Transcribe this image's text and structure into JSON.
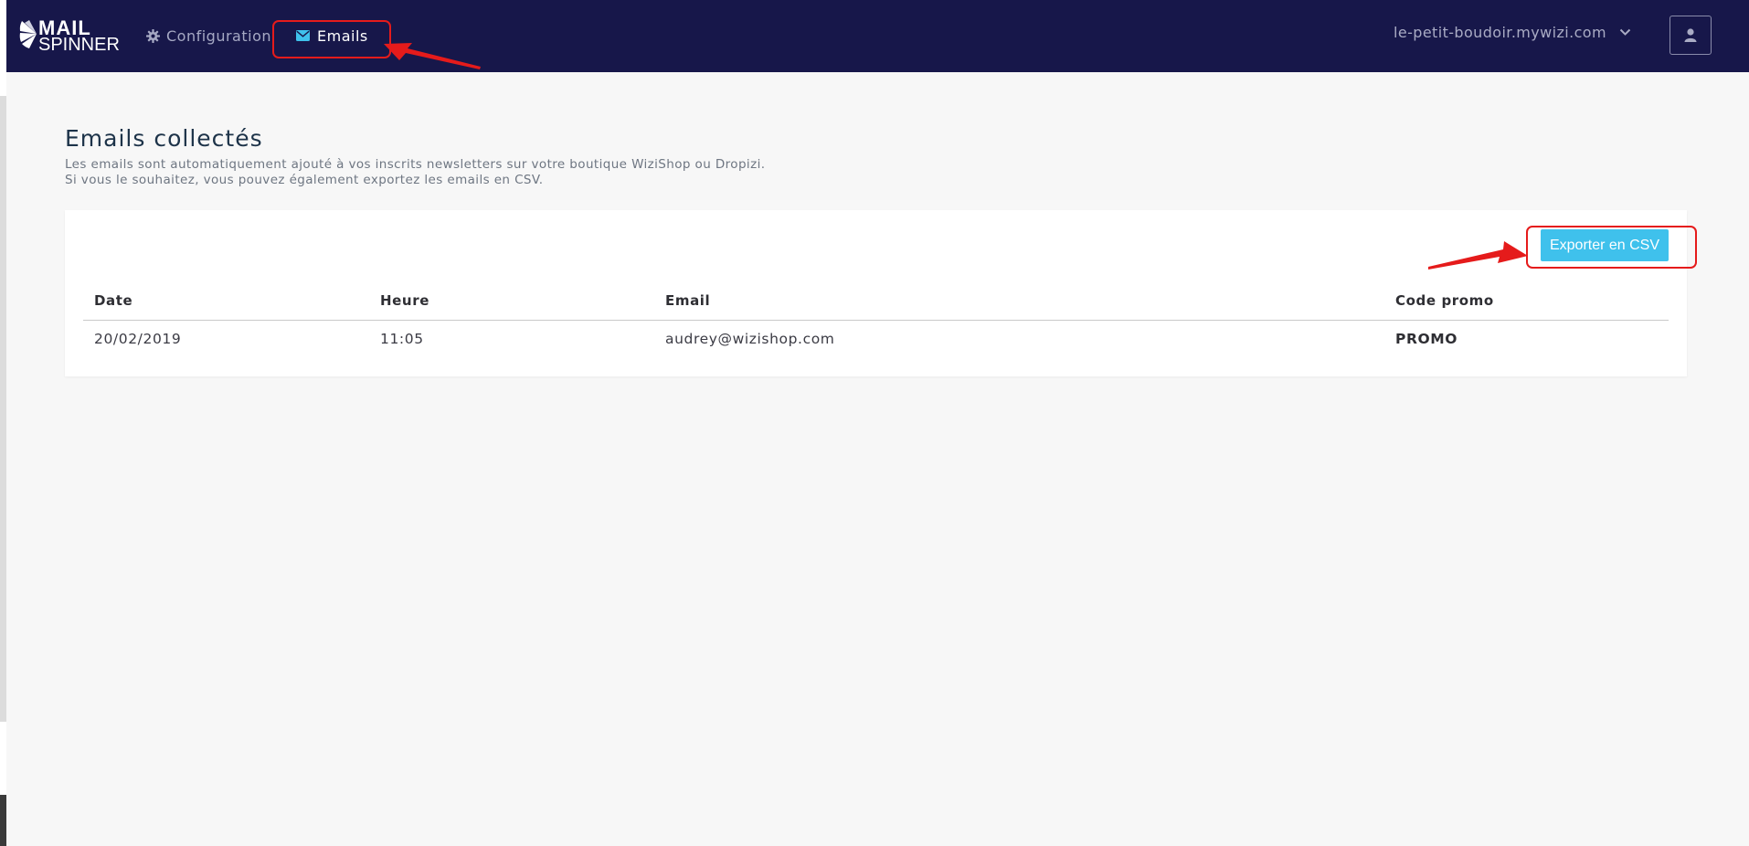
{
  "app": {
    "logo_line1": "MAIL",
    "logo_line2": "SPINNER"
  },
  "nav": {
    "configuration_label": "Configuration",
    "emails_label": "Emails"
  },
  "account": {
    "domain": "le-petit-boudoir.mywizi.com"
  },
  "page": {
    "title": "Emails collectés",
    "description_line1": "Les emails sont automatiquement ajouté à vos inscrits newsletters sur votre boutique WiziShop ou Dropizi.",
    "description_line2": "Si vous le souhaitez, vous pouvez également exportez les emails en CSV."
  },
  "actions": {
    "export_label": "Exporter en CSV"
  },
  "table": {
    "headers": [
      "Date",
      "Heure",
      "Email",
      "Code promo"
    ],
    "rows": [
      [
        "20/02/2019",
        "11:05",
        "audrey@wizishop.com",
        "PROMO"
      ]
    ]
  },
  "colors": {
    "topbar": "#17174a",
    "accent": "#3fc1ec",
    "annotation": "#e51b1b"
  },
  "icons": {
    "config": "gear-icon",
    "emails": "envelope-icon",
    "dropdown": "chevron-down-icon",
    "user": "user-icon"
  }
}
